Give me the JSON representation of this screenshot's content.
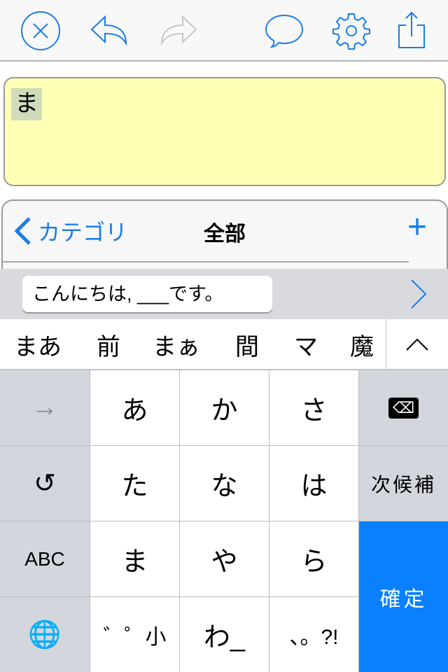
{
  "toolbar": {
    "icons": [
      "close-circle-icon",
      "undo-icon",
      "redo-icon",
      "speech-bubble-icon",
      "gear-icon",
      "share-icon"
    ],
    "accent": "#1a7ee6",
    "disabled": "#c8c8c8"
  },
  "note": {
    "text": "ま",
    "background": "#ffffb5"
  },
  "panel": {
    "back_label": "カテゴリ",
    "title": "全部",
    "add_label": "+"
  },
  "template": {
    "text": "こんにちは, ___です。"
  },
  "candidates": [
    "まあ",
    "前",
    "まぁ",
    "間",
    "マ",
    "魔"
  ],
  "keyboard": {
    "rows": [
      [
        "→",
        "あ",
        "か",
        "さ",
        "⌫"
      ],
      [
        "↺",
        "た",
        "な",
        "は",
        "次候補"
      ],
      [
        "ABC",
        "ま",
        "や",
        "ら",
        "確定"
      ],
      [
        "🌐",
        "゛゜小",
        "わ_",
        "、。?!"
      ]
    ],
    "enter_color": "#0a80ff"
  }
}
